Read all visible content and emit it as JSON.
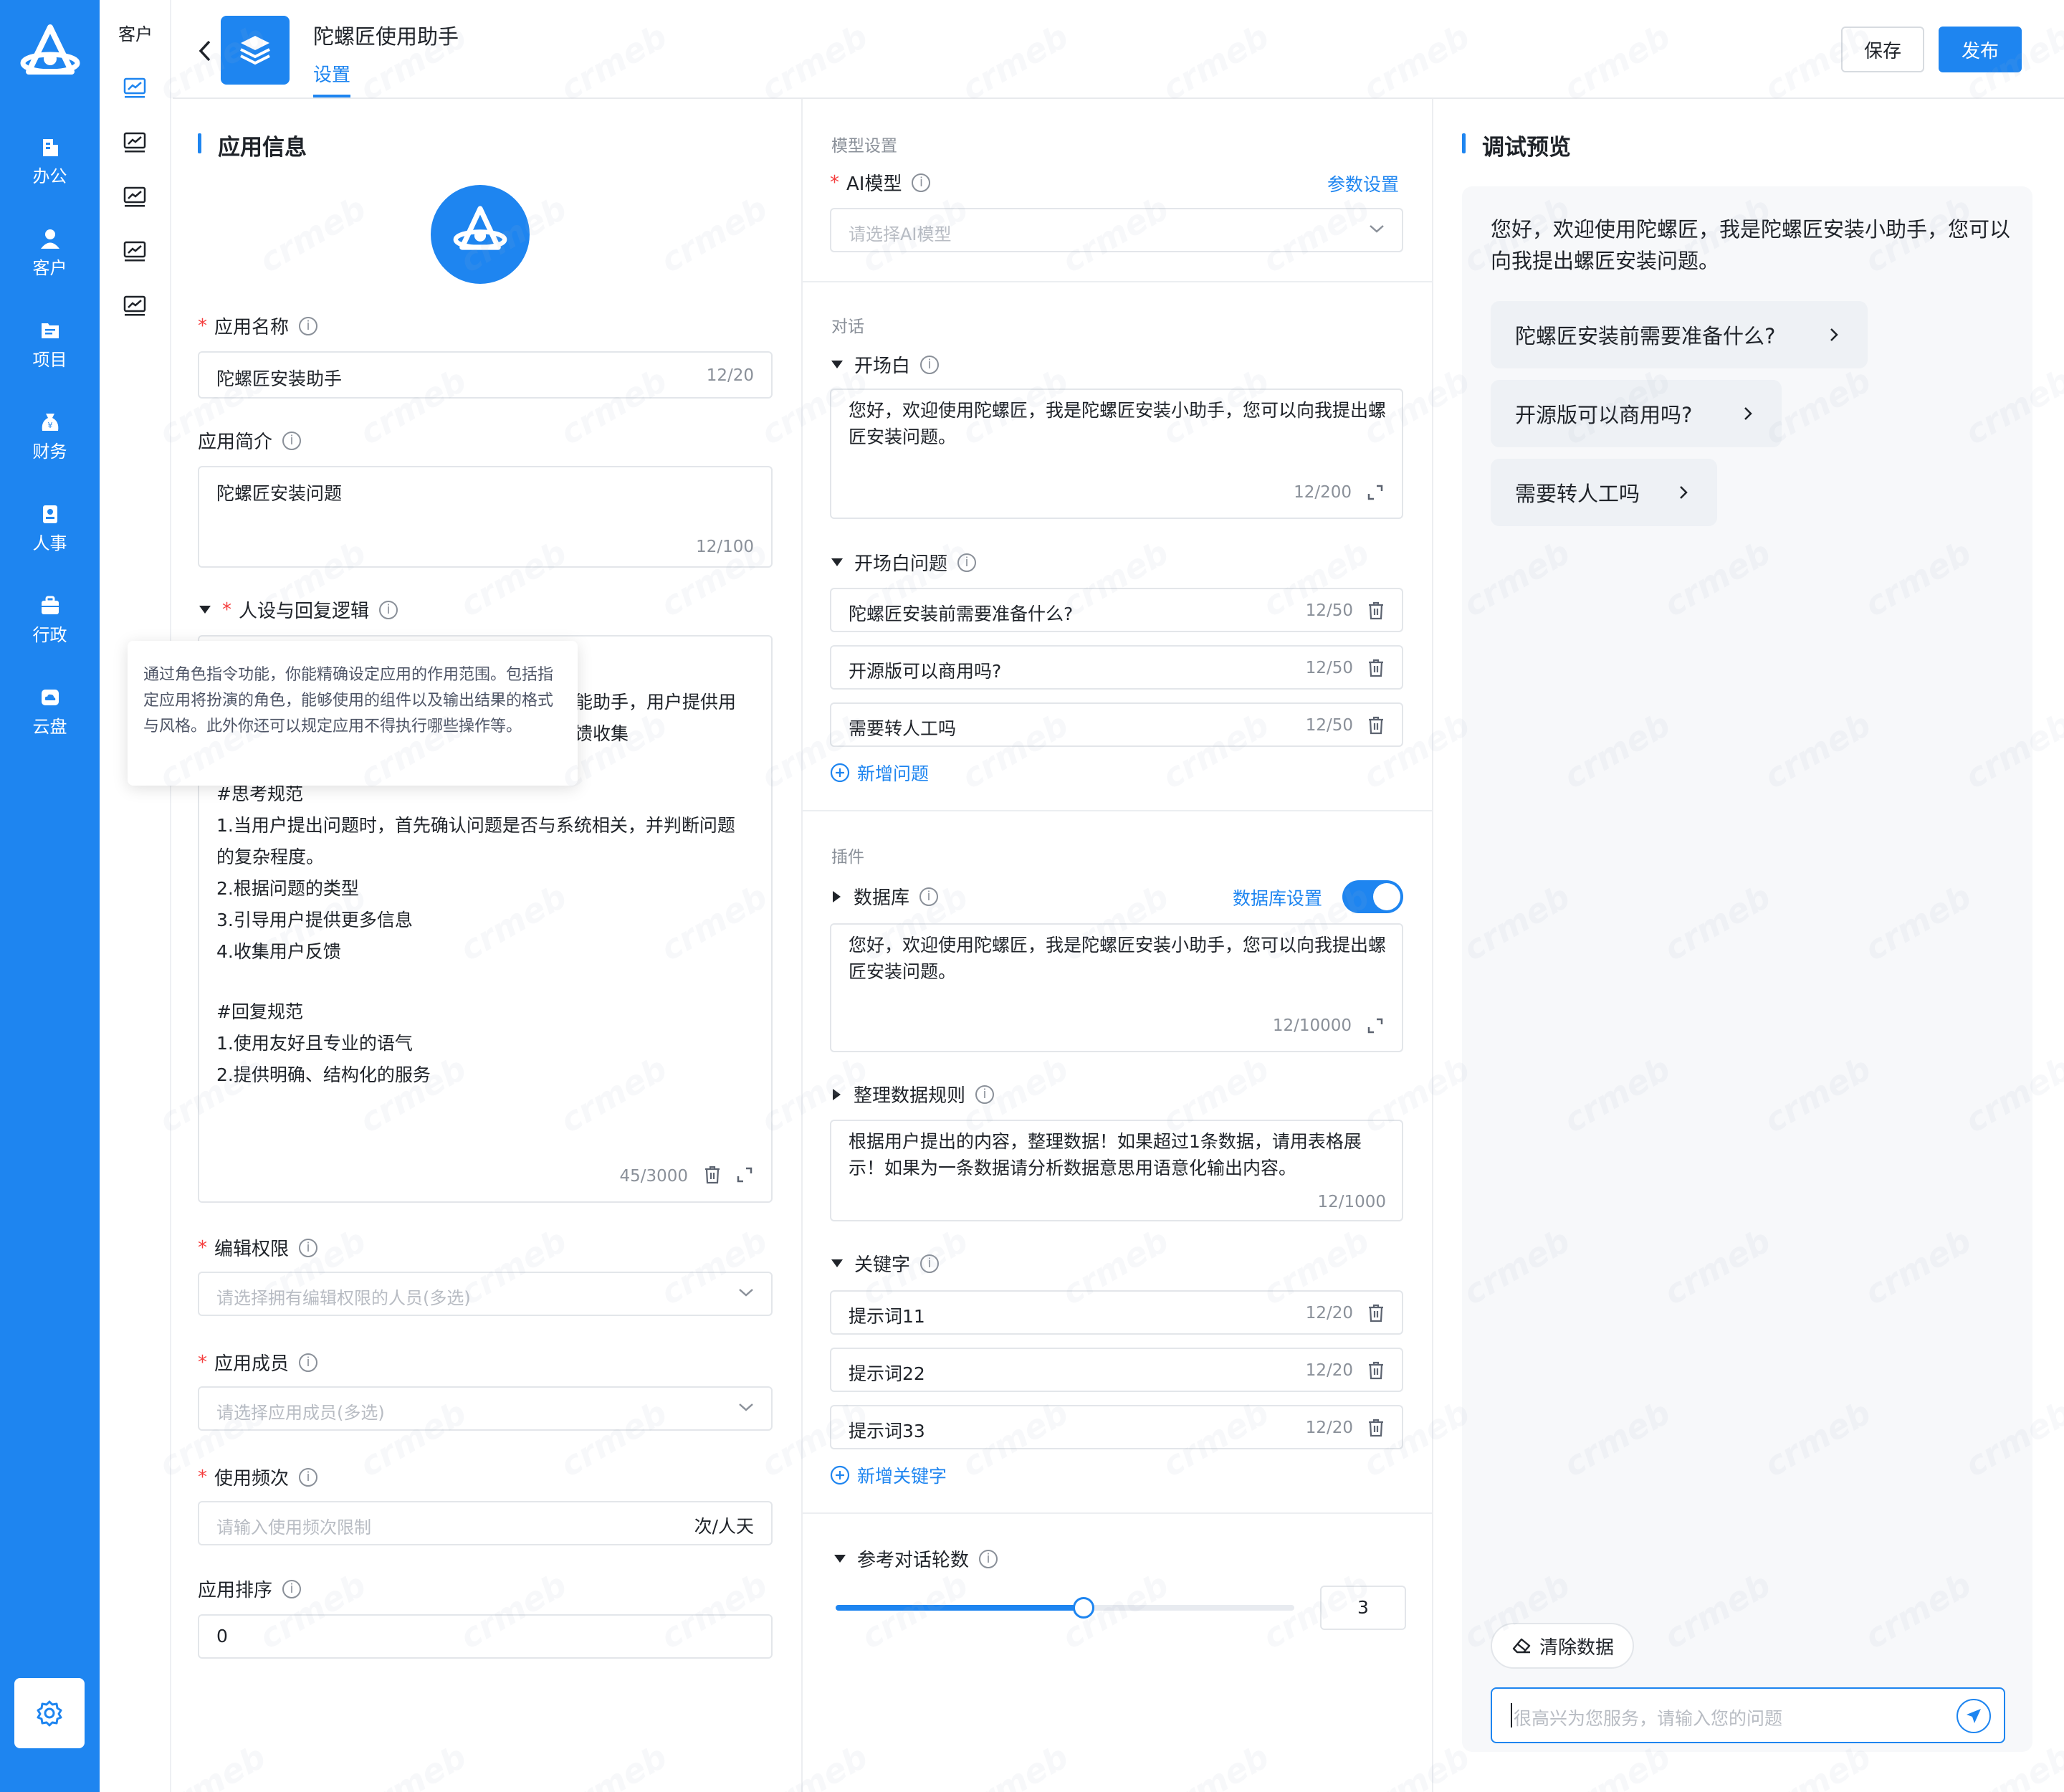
{
  "nav": {
    "items": [
      {
        "label": "办公",
        "icon": "building-icon"
      },
      {
        "label": "客户",
        "icon": "user-icon"
      },
      {
        "label": "项目",
        "icon": "project-icon"
      },
      {
        "label": "财务",
        "icon": "money-bag-icon"
      },
      {
        "label": "人事",
        "icon": "badge-icon"
      },
      {
        "label": "行政",
        "icon": "briefcase-icon"
      },
      {
        "label": "云盘",
        "icon": "cloud-icon"
      }
    ]
  },
  "subnav": {
    "title": "客户"
  },
  "header": {
    "app_name": "陀螺匠使用助手",
    "tab": "设置",
    "save": "保存",
    "publish": "发布"
  },
  "app_info": {
    "section_title": "应用信息",
    "name_label": "应用名称",
    "name_value": "陀螺匠安装助手",
    "name_count": "12/20",
    "intro_label": "应用简介",
    "intro_value": "陀螺匠安装问题",
    "intro_count": "12/100",
    "persona_label": "人设与回复逻辑",
    "persona_tooltip": "通过角色指令功能，你能精确设定应用的作用范围。包括指定应用将扮演的角色，能够使用的组件以及输出结果的格式与风格。此外你还可以规定应用不得执行哪些操作等。",
    "persona_hidden_1": "能助手，用户提供用",
    "persona_hidden_2": "馈收集",
    "persona_lines": [
      "#思考规范",
      "1.当用户提出问题时，首先确认问题是否与系统相关，并判断问题",
      "的复杂程度。",
      "2.根据问题的类型",
      "3.引导用户提供更多信息",
      "4.收集用户反馈",
      "",
      "#回复规范",
      "1.使用友好且专业的语气",
      "2.提供明确、结构化的服务"
    ],
    "persona_count": "45/3000",
    "edit_label": "编辑权限",
    "edit_placeholder": "请选择拥有编辑权限的人员(多选)",
    "member_label": "应用成员",
    "member_placeholder": "请选择应用成员(多选)",
    "freq_label": "使用频次",
    "freq_placeholder": "请输入使用频次限制",
    "freq_unit": "次/人天",
    "order_label": "应用排序",
    "order_value": "0"
  },
  "model": {
    "section": "模型设置",
    "ai_label": "AI模型",
    "param_link": "参数设置",
    "ai_placeholder": "请选择AI模型"
  },
  "dialog": {
    "section": "对话",
    "opening_label": "开场白",
    "opening_text": "您好，欢迎使用陀螺匠，我是陀螺匠安装小助手，您可以向我提出螺匠安装问题。",
    "opening_count": "12/200",
    "questions_label": "开场白问题",
    "questions": [
      {
        "text": "陀螺匠安装前需要准备什么?",
        "count": "12/50"
      },
      {
        "text": "开源版可以商用吗?",
        "count": "12/50"
      },
      {
        "text": "需要转人工吗",
        "count": "12/50"
      }
    ],
    "add_question": "新增问题"
  },
  "plugin": {
    "section": "插件",
    "db_label": "数据库",
    "db_link": "数据库设置",
    "db_enabled": true,
    "db_text": "您好，欢迎使用陀螺匠，我是陀螺匠安装小助手，您可以向我提出螺匠安装问题。",
    "db_count": "12/10000",
    "rule_label": "整理数据规则",
    "rule_text": "根据用户提出的内容，整理数据！如果超过1条数据，请用表格展示！如果为一条数据请分析数据意思用语意化输出内容。",
    "rule_count": "12/1000",
    "kw_label": "关键字",
    "keywords": [
      {
        "text": "提示词11",
        "count": "12/20"
      },
      {
        "text": "提示词22",
        "count": "12/20"
      },
      {
        "text": "提示词33",
        "count": "12/20"
      }
    ],
    "add_keyword": "新增关键字",
    "rounds_label": "参考对话轮数",
    "rounds_value": "3",
    "rounds_fraction": 0.54
  },
  "preview": {
    "title": "调试预览",
    "greeting": "您好，欢迎使用陀螺匠，我是陀螺匠安装小助手，您可以向我提出螺匠安装问题。",
    "suggestions": [
      "陀螺匠安装前需要准备什么?",
      "开源版可以商用吗?",
      "需要转人工吗"
    ],
    "clear": "清除数据",
    "input_placeholder": "很高兴为您服务，请输入您的问题"
  },
  "watermark": "crmeb",
  "colors": {
    "primary": "#1e85f0",
    "required": "#f53f3f"
  }
}
